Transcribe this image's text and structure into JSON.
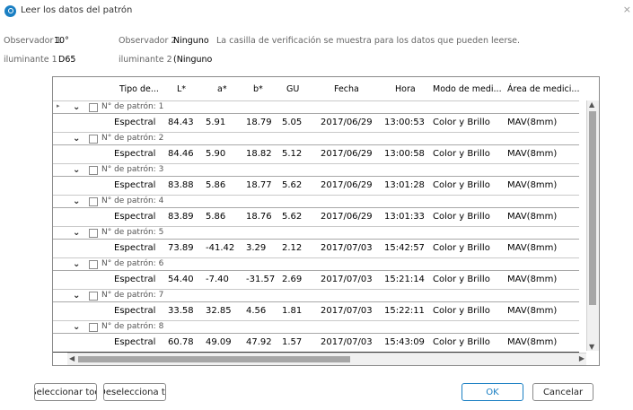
{
  "window": {
    "title": "Leer los datos del patrón",
    "close": "×"
  },
  "info": {
    "observador1_label": "Observador 1",
    "observador1_value": "10°",
    "observador2_label": "Observador 2",
    "observador2_value": "Ninguno",
    "note": "La casilla de verificación se muestra para los datos que pueden leerse.",
    "iluminante1_label": "iluminante 1",
    "iluminante1_value": "D65",
    "iluminante2_label": "iluminante 2",
    "iluminante2_value": "(Ninguno"
  },
  "table": {
    "headers": [
      "Tipo de...",
      "L*",
      "a*",
      "b*",
      "GU",
      "Fecha",
      "Hora",
      "Modo de medi...",
      "Área de medici..."
    ],
    "group_label_prefix": "N° de patrón:",
    "groups": [
      {
        "label": "N° de patrón: 1",
        "row": [
          "Espectral",
          "84.43",
          "5.91",
          "18.79",
          "5.05",
          "2017/06/29",
          "13:00:53",
          "Color y Brillo",
          "MAV(8mm)"
        ]
      },
      {
        "label": "N° de patrón: 2",
        "row": [
          "Espectral",
          "84.46",
          "5.90",
          "18.82",
          "5.12",
          "2017/06/29",
          "13:00:58",
          "Color y Brillo",
          "MAV(8mm)"
        ]
      },
      {
        "label": "N° de patrón: 3",
        "row": [
          "Espectral",
          "83.88",
          "5.86",
          "18.77",
          "5.62",
          "2017/06/29",
          "13:01:28",
          "Color y Brillo",
          "MAV(8mm)"
        ]
      },
      {
        "label": "N° de patrón: 4",
        "row": [
          "Espectral",
          "83.89",
          "5.86",
          "18.76",
          "5.62",
          "2017/06/29",
          "13:01:33",
          "Color y Brillo",
          "MAV(8mm)"
        ]
      },
      {
        "label": "N° de patrón: 5",
        "row": [
          "Espectral",
          "73.89",
          "-41.42",
          "3.29",
          "2.12",
          "2017/07/03",
          "15:42:57",
          "Color y Brillo",
          "MAV(8mm)"
        ]
      },
      {
        "label": "N° de patrón: 6",
        "row": [
          "Espectral",
          "54.40",
          "-7.40",
          "-31.57",
          "2.69",
          "2017/07/03",
          "15:21:14",
          "Color y Brillo",
          "MAV(8mm)"
        ]
      },
      {
        "label": "N° de patrón: 7",
        "row": [
          "Espectral",
          "33.58",
          "32.85",
          "4.56",
          "1.81",
          "2017/07/03",
          "15:22:11",
          "Color y Brillo",
          "MAV(8mm)"
        ]
      },
      {
        "label": "N° de patrón: 8",
        "row": [
          "Espectral",
          "60.78",
          "49.09",
          "47.92",
          "1.57",
          "2017/07/03",
          "15:43:09",
          "Color y Brillo",
          "MAV(8mm)"
        ]
      }
    ]
  },
  "buttons": {
    "select_all": "Seleccionar tod",
    "deselect_all": "Deselecciona to",
    "ok": "OK",
    "cancel": "Cancelar"
  },
  "colors": {
    "accent": "#1a7fc3"
  }
}
